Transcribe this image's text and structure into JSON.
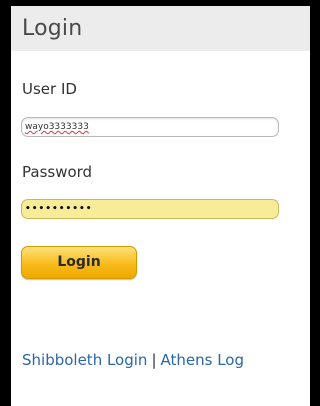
{
  "login_panel": {
    "title": "Login",
    "user_id": {
      "label": "User ID",
      "value": "wayo3333333"
    },
    "password": {
      "label": "Password",
      "masked_value": "••••••••••"
    },
    "login_button_label": "Login",
    "links": {
      "shibboleth": "Shibboleth Login",
      "separator": "|",
      "athens": "Athens Log"
    }
  },
  "colors": {
    "title_bar": "#ececec",
    "password_fill": "#f8ec98",
    "button": "#f7bb1b",
    "link": "#2b67a6"
  }
}
